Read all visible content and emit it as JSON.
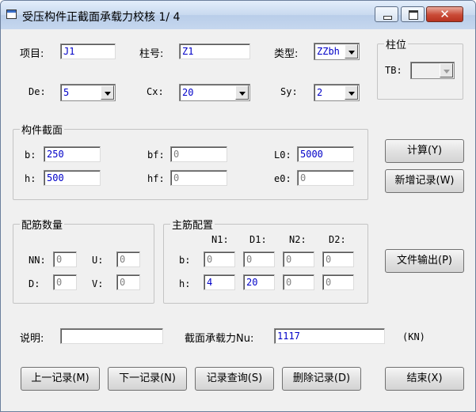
{
  "window": {
    "title": "受压构件正截面承载力校核 1/ 4",
    "controls": {
      "close_glyph": "✕"
    }
  },
  "top": {
    "project_label": "项目:",
    "project_value": "J1",
    "column_no_label": "柱号:",
    "column_no_value": "Z1",
    "type_label": "类型:",
    "type_value": "ZZbh",
    "de_label": "De:",
    "de_value": "5",
    "cx_label": "Cx:",
    "cx_value": "20",
    "sy_label": "Sy:",
    "sy_value": "2"
  },
  "column_position": {
    "title": "柱位",
    "tb_label": "TB:",
    "tb_value": ""
  },
  "section": {
    "title": "构件截面",
    "b_label": "b:",
    "b_value": "250",
    "h_label": "h:",
    "h_value": "500",
    "bf_label": "bf:",
    "bf_value": "0",
    "hf_label": "hf:",
    "hf_value": "0",
    "l0_label": "L0:",
    "l0_value": "5000",
    "e0_label": "e0:",
    "e0_value": "0"
  },
  "rebar_qty": {
    "title": "配筋数量",
    "nn_label": "NN:",
    "nn_value": "0",
    "u_label": "U:",
    "u_value": "0",
    "d_label": "D:",
    "d_value": "0",
    "v_label": "V:",
    "v_value": "0"
  },
  "main_rebar": {
    "title": "主筋配置",
    "headers": [
      "N1:",
      "D1:",
      "N2:",
      "D2:"
    ],
    "row_b_label": "b:",
    "row_b": [
      "0",
      "0",
      "0",
      "0"
    ],
    "row_h_label": "h:",
    "row_h": [
      "4",
      "20",
      "0",
      "0"
    ]
  },
  "bottom": {
    "note_label": "说明:",
    "note_value": "",
    "capacity_label": "截面承载力Nu:",
    "capacity_value": "1117",
    "unit": "(KN)"
  },
  "buttons": {
    "calculate": "计算(Y)",
    "add_record": "新增记录(W)",
    "file_output": "文件输出(P)",
    "prev_record": "上一记录(M)",
    "next_record": "下一记录(N)",
    "query_record": "记录查询(S)",
    "delete_record": "删除记录(D)",
    "finish": "结束(X)"
  }
}
